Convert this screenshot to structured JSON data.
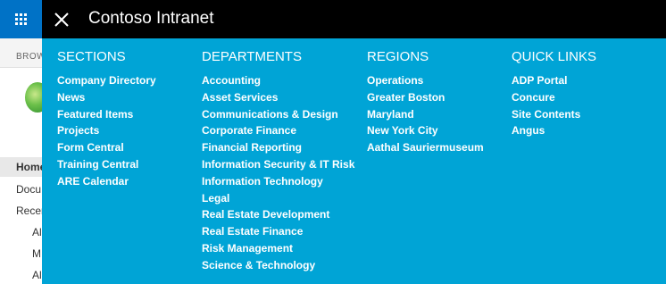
{
  "suite_bar": {
    "title": "Contoso Intranet"
  },
  "background": {
    "ribbon_label": "BROW",
    "nav_items": [
      "Home",
      "Docu",
      "Recen",
      "Al",
      "M",
      "Al"
    ]
  },
  "menu": {
    "columns": [
      {
        "heading": "SECTIONS",
        "links": [
          "Company Directory",
          "News",
          "Featured Items",
          "Projects",
          "Form Central",
          "Training Central",
          "ARE Calendar"
        ]
      },
      {
        "heading": "DEPARTMENTS",
        "links": [
          "Accounting",
          "Asset Services",
          "Communications & Design",
          "Corporate Finance",
          "Financial Reporting",
          "Information Security & IT Risk",
          "Information Technology",
          "Legal",
          "Real Estate Development",
          "Real Estate Finance",
          "Risk Management",
          "Science & Technology"
        ]
      },
      {
        "heading": "REGIONS",
        "links": [
          "Operations",
          "Greater Boston",
          "Maryland",
          "New York City",
          "Aathal Sauriermuseum"
        ]
      },
      {
        "heading": "QUICK LINKS",
        "links": [
          "ADP Portal",
          "Concure",
          "Site Contents",
          "Angus"
        ]
      }
    ]
  },
  "colors": {
    "suite_bar": "#000000",
    "app_launcher": "#0072c6",
    "menu_background": "#00a4d6",
    "text": "#ffffff"
  }
}
